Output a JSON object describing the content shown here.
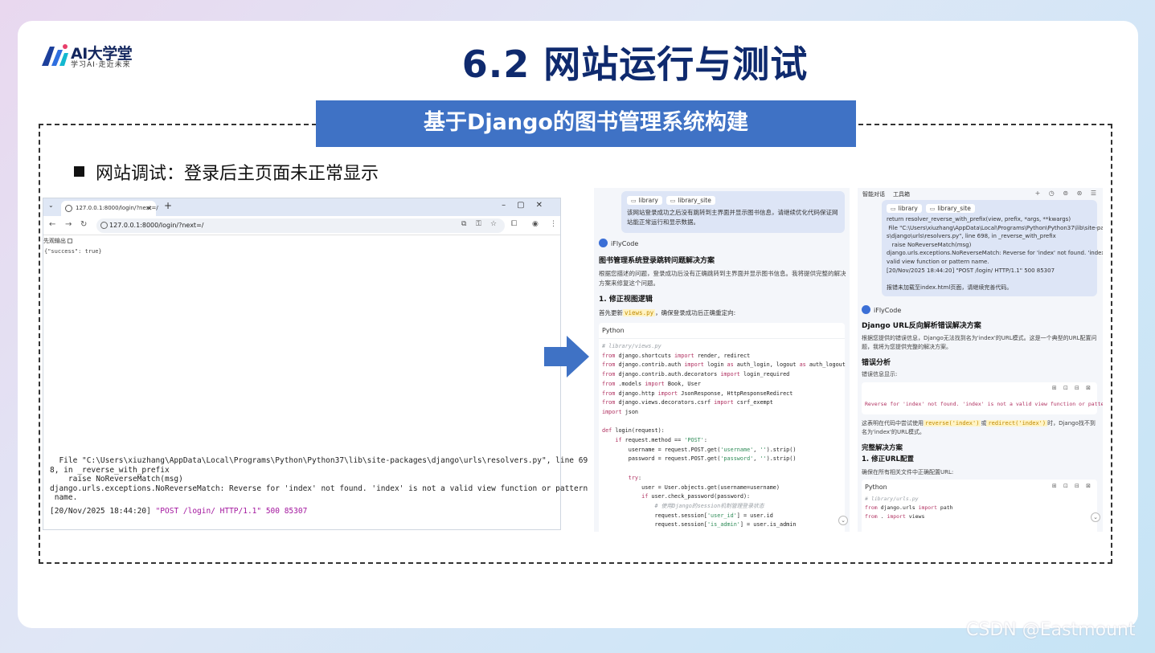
{
  "slide": {
    "title": "6.2 网站运行与测试",
    "banner": "基于Django的图书管理系统构建",
    "bullet": "网站调试：登录后主页面未正常显示"
  },
  "logo": {
    "name": "AI大学堂",
    "subtitle": "学习AI·走近未来"
  },
  "browser": {
    "tab_title": "127.0.0.1:8000/login/?next=/",
    "url": "127.0.0.1:8000/login/?next=/",
    "pretty_print_label": "先观输出",
    "json_body": "{\"success\": true}",
    "terminal_lines": [
      "  File \"C:\\Users\\xiuzhang\\AppData\\Local\\Programs\\Python\\Python37\\lib\\site-packages\\django\\urls\\resolvers.py\", line 69",
      "8, in _reverse_with_prefix",
      "    raise NoReverseMatch(msg)",
      "django.urls.exceptions.NoReverseMatch: Reverse for 'index' not found. 'index' is not a valid view function or pattern",
      " name."
    ],
    "terminal_last_prefix": "[20/Nov/2025 18:44:20] ",
    "terminal_last_request": "\"POST /login/ HTTP/1.1\" 500 85307"
  },
  "panel1": {
    "chip_1": "library",
    "chip_2": "library_site",
    "user_message": "该网站登录成功之后没有跳转到主界面并显示图书信息，请继续优化代码保证网站能正常运行和显示数据。",
    "assistant_name": "iFlyCode",
    "heading": "图书管理系统登录跳转问题解决方案",
    "description": "根据您描述的问题，登录成功后没有正确跳转到主界面并显示图书信息。我将提供完整的解决方案来修复这个问题。",
    "section_1": "1. 修正视图逻辑",
    "line_before": "首先更新",
    "inline_file": "views.py",
    "line_after": "，确保登录成功后正确重定向:",
    "code_lang": "Python",
    "code": [
      "# library/views.py",
      "from django.shortcuts import render, redirect",
      "from django.contrib.auth import login as auth_login, logout as auth_logout",
      "from django.contrib.auth.decorators import login_required",
      "from .models import Book, User",
      "from django.http import JsonResponse, HttpResponseRedirect",
      "from django.views.decorators.csrf import csrf_exempt",
      "import json",
      "",
      "def login(request):",
      "    if request.method == 'POST':",
      "        username = request.POST.get('username', '').strip()",
      "        password = request.POST.get('password', '').strip()",
      "",
      "        try:",
      "            user = User.objects.get(username=username)",
      "            if user.check_password(password):",
      "                # 使用Django的session机制管理登录状态",
      "                request.session['user_id'] = user.id",
      "                request.session['is_admin'] = user.is_admin"
    ]
  },
  "panel2": {
    "tab_1": "智能对话",
    "tab_2": "工具箱",
    "top_icons": "+ ◷ ⊚ ⊛ ☰",
    "chip_1": "library",
    "chip_2": "library_site",
    "user_message": "return resolver_reverse_with_prefix(view, prefix, *args, **kwargs)\n File \"C:\\Users\\xiuzhang\\AppData\\Local\\Programs\\Python\\Python37\\lib\\site-package\ns\\django\\urls\\resolvers.py\", line 698, in _reverse_with_prefix\n   raise NoReverseMatch(msg)\ndjango.urls.exceptions.NoReverseMatch: Reverse for 'index' not found. 'index' is not a\nvalid view function or pattern name.\n[20/Nov/2025 18:44:20] \"POST /login/ HTTP/1.1\" 500 85307\n\n报错未加载至index.html页面，请继续完善代码。",
    "assistant_name": "iFlyCode",
    "heading": "Django URL反向解析错误解决方案",
    "description": "根据您提供的错误信息，Django无法找到名为'index'的URL模式。这是一个典型的URL配置问题，我将为您提供完整的解决方案。",
    "section_error": "错误分析",
    "error_label": "错误信息显示:",
    "box_tools": "⊞ ⊡ ⊟ ⊠",
    "error_text": "Reverse for 'index' not found. 'index' is not a valid view function or pattern name.",
    "explain_prefix": "这表明在代码中尝试使用",
    "explain_code_1": "reverse('index')",
    "explain_mid": "或",
    "explain_code_2": "redirect('index')",
    "explain_suffix": "时，Django找不到名为'index'的URL模式。",
    "section_full": "完整解决方案",
    "section_1": "1. 修正URL配置",
    "config_line": "确保在所有相关文件中正确配置URL:",
    "code_lang": "Python",
    "code": [
      "# library/urls.py",
      "from django.urls import path",
      "from . import views"
    ]
  },
  "watermark": "CSDN @Eastmount"
}
